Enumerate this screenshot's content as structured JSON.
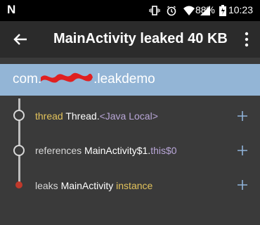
{
  "status_bar": {
    "battery_pct": "88%",
    "time": "10:23"
  },
  "toolbar": {
    "title": "MainActivity leaked 40 KB"
  },
  "header": {
    "package": "com.              .leakdemo"
  },
  "trace": {
    "rows": [
      {
        "keyword": "thread",
        "class": "Thread.",
        "detail": "<Java Local>"
      },
      {
        "keyword": "references",
        "class": "MainActivity$1.",
        "detail": "this$0"
      },
      {
        "keyword": "leaks",
        "class": "MainActivity",
        "detail": "instance"
      }
    ]
  }
}
